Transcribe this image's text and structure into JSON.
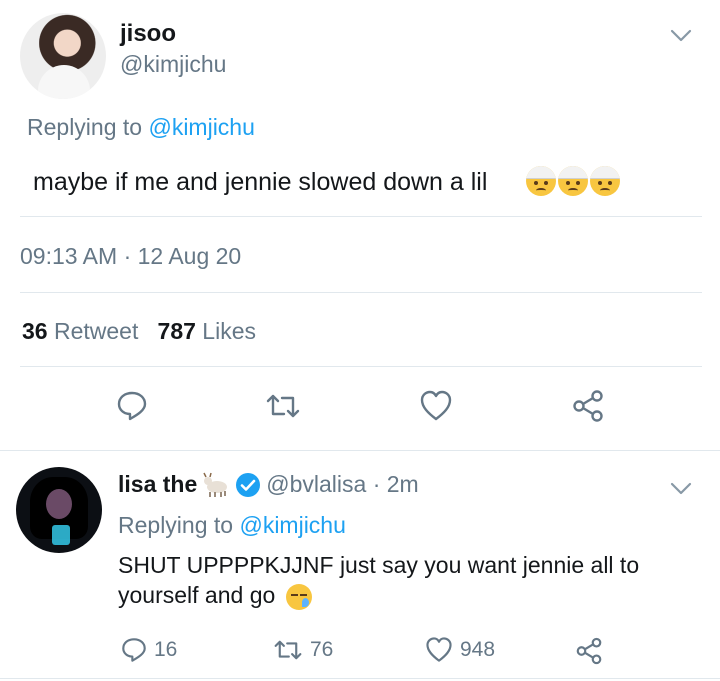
{
  "main_tweet": {
    "name": "jisoo",
    "handle": "@kimjichu",
    "replying_prefix": "Replying to ",
    "replying_to": "@kimjichu",
    "text": "maybe if me and jennie slowed down a lil",
    "emojis": [
      "bandaged-face-emoji",
      "bandaged-face-emoji",
      "bandaged-face-emoji"
    ],
    "timestamp": "09:13 AM · 12 Aug 20",
    "retweet_count": "36",
    "retweet_label": "Retweet",
    "like_count": "787",
    "like_label": "Likes"
  },
  "reply_tweet": {
    "name": "lisa the",
    "name_emoji": "goat-emoji",
    "verified_icon": "verified-badge-icon",
    "handle_time": "@bvlalisa · 2m",
    "replying_prefix": "Replying to ",
    "replying_to": "@kimjichu",
    "text": "SHUT UPPPPKJJNF just say you want jennie all to yourself and go",
    "text_emoji": "sleepy-face-emoji",
    "reply_count": "16",
    "retweet_count": "76",
    "like_count": "948"
  },
  "colors": {
    "accent": "#1da1f2",
    "muted": "#657786",
    "divider": "#e1e8ed",
    "text": "#14171a"
  }
}
